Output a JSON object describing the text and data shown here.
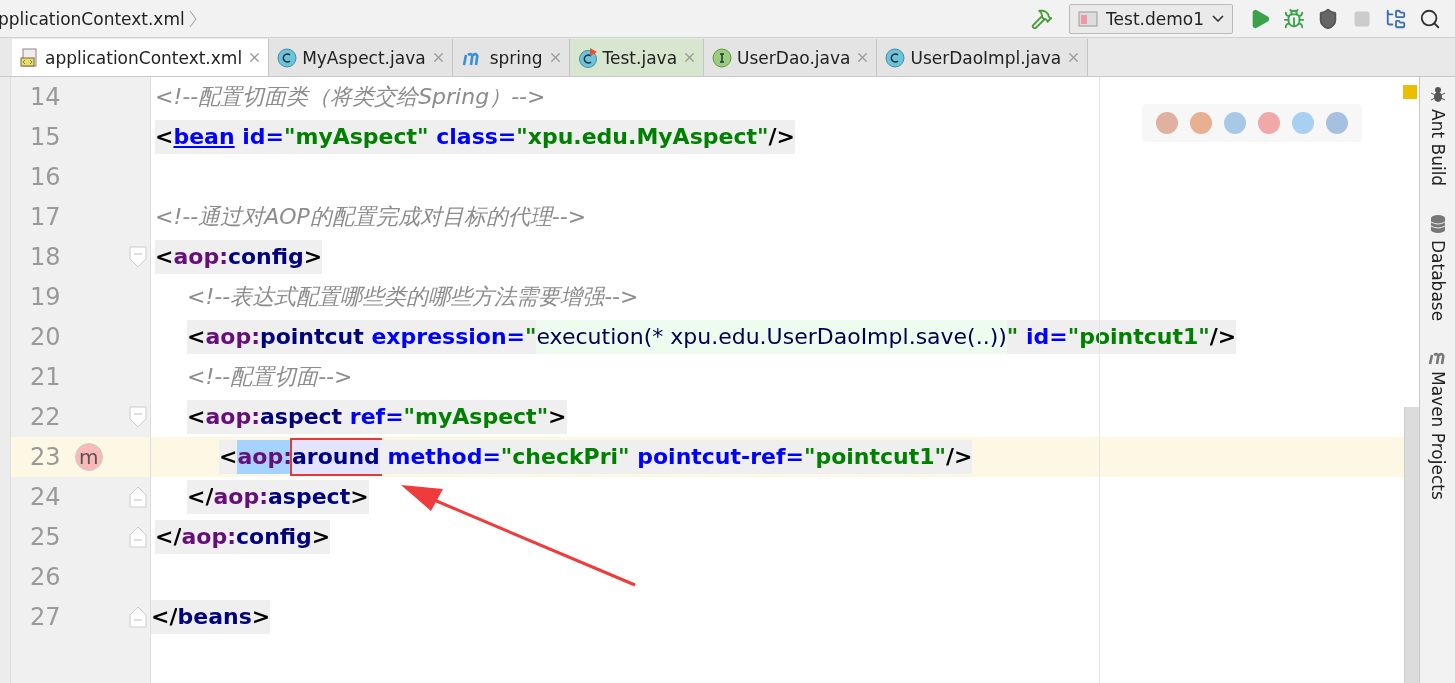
{
  "breadcrumb": "pplicationContext.xml",
  "toolbar": {
    "run_config": "Test.demo1",
    "stop_disabled": true
  },
  "tabs": [
    {
      "label": "applicationContext.xml",
      "kind": "xml",
      "selected": true
    },
    {
      "label": "MyAspect.java",
      "kind": "class",
      "selected": false
    },
    {
      "label": "spring",
      "kind": "maven",
      "selected": false
    },
    {
      "label": "Test.java",
      "kind": "test",
      "selected": false
    },
    {
      "label": "UserDao.java",
      "kind": "interface",
      "selected": false
    },
    {
      "label": "UserDaoImpl.java",
      "kind": "class",
      "selected": false
    }
  ],
  "code": [
    {
      "kind": "block",
      "children": [
        {
          "kind": "line",
          "number": "14",
          "tokens": [
            {
              "kind": "comment",
              "text": "<!--配置切面类（将类交给Spring）-->"
            }
          ]
        },
        {
          "kind": "line",
          "number": "15",
          "tokens": [
            {
              "kind": "punct",
              "text": "<"
            },
            {
              "kind": "link",
              "text": "bean"
            },
            {
              "kind": "attr",
              "text": " id="
            },
            {
              "kind": "value",
              "text": "\"myAspect\""
            },
            {
              "kind": "attr",
              "text": " class="
            },
            {
              "kind": "value",
              "text": "\"xpu.edu.MyAspect\""
            },
            {
              "kind": "punct",
              "text": "/>"
            }
          ]
        },
        {
          "kind": "line",
          "number": "16"
        },
        {
          "kind": "line",
          "number": "17",
          "tokens": [
            {
              "kind": "comment",
              "text": "<!--通过对AOP的配置完成对目标的代理-->"
            }
          ]
        },
        {
          "kind": "fold-start",
          "number": "18",
          "tokens": [
            {
              "kind": "punct",
              "text": "<"
            },
            {
              "kind": "ns",
              "text": "aop:"
            },
            {
              "kind": "name",
              "text": "config"
            },
            {
              "kind": "punct",
              "text": ">"
            }
          ],
          "children": [
            {
              "kind": "line",
              "number": "19",
              "tokens": [
                {
                  "kind": "comment",
                  "text": "<!--表达式配置哪些类的哪些方法需要增强-->"
                }
              ]
            },
            {
              "kind": "line",
              "number": "20",
              "tokens": [
                {
                  "kind": "punct",
                  "text": "<"
                },
                {
                  "kind": "ns",
                  "text": "aop:"
                },
                {
                  "kind": "name",
                  "text": "pointcut"
                },
                {
                  "kind": "attr",
                  "text": " expression="
                },
                {
                  "kind": "value",
                  "text": "\""
                },
                {
                  "kind": "injected",
                  "text": "execution(* xpu.edu.UserDaoImpl.save(..))"
                },
                {
                  "kind": "value",
                  "text": "\""
                },
                {
                  "kind": "attr",
                  "text": " id="
                },
                {
                  "kind": "value",
                  "text": "\"pointcut1\""
                },
                {
                  "kind": "punct",
                  "text": "/>"
                }
              ]
            },
            {
              "kind": "line",
              "number": "21",
              "tokens": [
                {
                  "kind": "comment",
                  "text": "<!--配置切面-->"
                }
              ]
            },
            {
              "kind": "fold-start",
              "number": "22",
              "tokens": [
                {
                  "kind": "punct",
                  "text": "<"
                },
                {
                  "kind": "ns",
                  "text": "aop:"
                },
                {
                  "kind": "name",
                  "text": "aspect"
                },
                {
                  "kind": "attr",
                  "text": " ref="
                },
                {
                  "kind": "value",
                  "text": "\"myAspect\""
                },
                {
                  "kind": "punct",
                  "text": ">"
                }
              ],
              "children": [
                {
                  "kind": "line",
                  "number": "23",
                  "current": true,
                  "badge": "m",
                  "tokens": [
                    {
                      "kind": "punct",
                      "text": "<"
                    },
                    {
                      "kind": "ns-selected",
                      "text": "aop:"
                    },
                    {
                      "kind": "name-boxed",
                      "text": "around"
                    },
                    {
                      "kind": "attr",
                      "text": " method="
                    },
                    {
                      "kind": "value",
                      "text": "\"checkPri\""
                    },
                    {
                      "kind": "attr",
                      "text": " pointcut-ref="
                    },
                    {
                      "kind": "value",
                      "text": "\"pointcut1\""
                    },
                    {
                      "kind": "punct",
                      "text": "/>"
                    }
                  ]
                }
              ]
            },
            {
              "kind": "fold-end",
              "number": "24",
              "tokens": [
                {
                  "kind": "punct",
                  "text": "</"
                },
                {
                  "kind": "ns",
                  "text": "aop:"
                },
                {
                  "kind": "name",
                  "text": "aspect"
                },
                {
                  "kind": "punct",
                  "text": ">"
                }
              ]
            }
          ]
        },
        {
          "kind": "fold-end",
          "number": "25",
          "tokens": [
            {
              "kind": "punct",
              "text": "</"
            },
            {
              "kind": "ns",
              "text": "aop:"
            },
            {
              "kind": "name",
              "text": "config"
            },
            {
              "kind": "punct",
              "text": ">"
            }
          ]
        },
        {
          "kind": "line",
          "number": "26"
        }
      ]
    },
    {
      "kind": "fold-end",
      "number": "27",
      "tokens": [
        {
          "kind": "punct",
          "text": "</"
        },
        {
          "kind": "name",
          "text": "beans"
        },
        {
          "kind": "punct",
          "text": ">"
        }
      ]
    }
  ],
  "annotation": {
    "kind": "arrow"
  },
  "side_tools": [
    {
      "label": "Ant Build",
      "kind": "ant"
    },
    {
      "label": "Database",
      "kind": "database"
    },
    {
      "label": "Maven Projects",
      "kind": "maven"
    }
  ]
}
